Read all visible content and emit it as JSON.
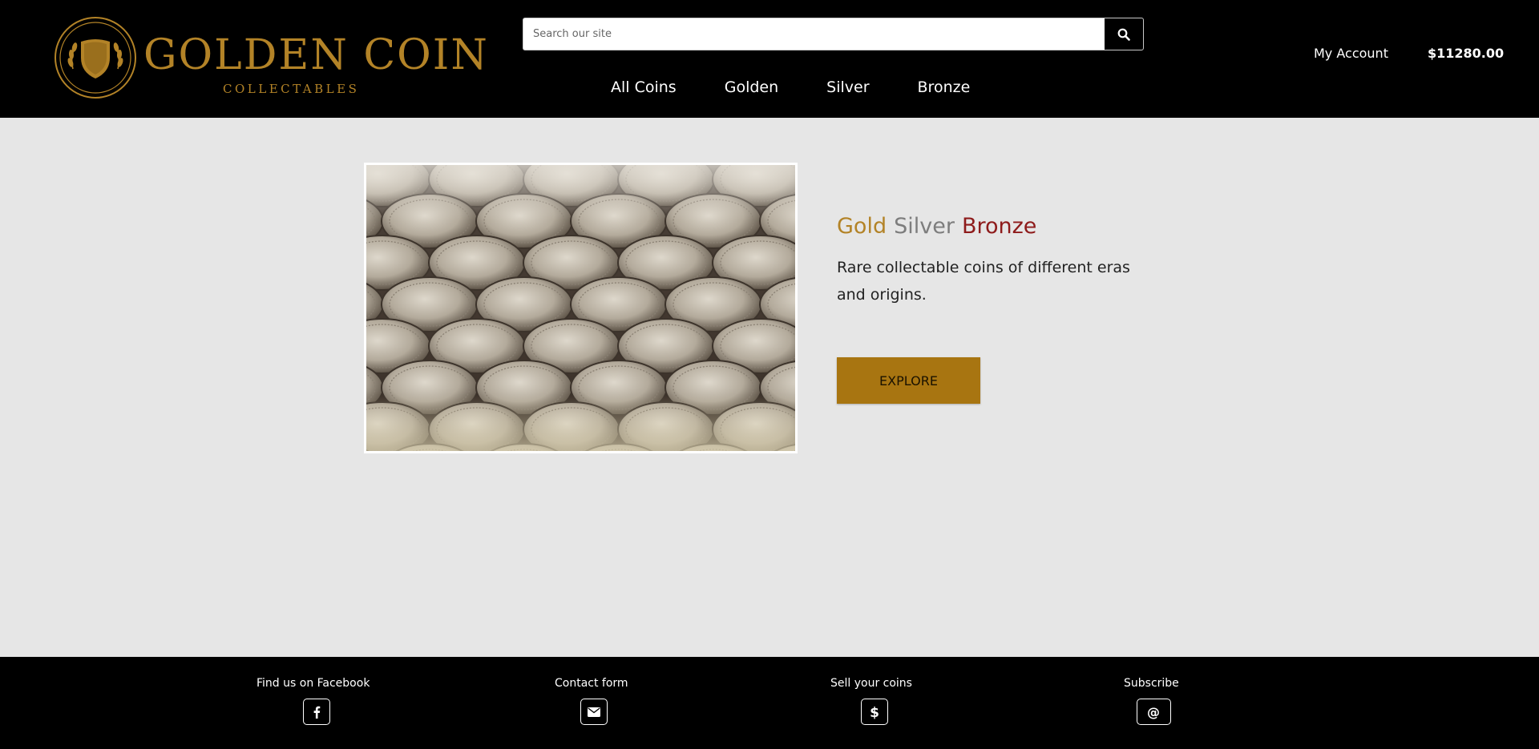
{
  "header": {
    "logo": {
      "title": "GOLDEN COIN",
      "subtitle": "COLLECTABLES",
      "icon": "shield-laurel-coin-icon"
    },
    "search": {
      "placeholder": "Search our site",
      "value": "",
      "button_icon": "search-icon"
    },
    "nav": [
      {
        "label": "All Coins"
      },
      {
        "label": "Golden"
      },
      {
        "label": "Silver"
      },
      {
        "label": "Bronze"
      }
    ],
    "account_label": "My Account",
    "cart_total": "$11280.00"
  },
  "hero": {
    "heading": [
      {
        "text": "Gold",
        "color": "#b38327"
      },
      {
        "text": "Silver",
        "color": "#7d7d7d"
      },
      {
        "text": "Bronze",
        "color": "#8e1b1b"
      }
    ],
    "description": "Rare collectable coins of different eras and origins.",
    "button_label": "EXPLORE"
  },
  "footer": {
    "items": [
      {
        "label": "Find us on Facebook",
        "icon": "facebook-icon"
      },
      {
        "label": "Contact form",
        "icon": "envelope-icon"
      },
      {
        "label": "Sell your coins",
        "icon": "dollar-icon"
      },
      {
        "label": "Subscribe",
        "icon": "at-sign-icon"
      }
    ]
  },
  "colors": {
    "header_bg": "#000000",
    "brand_gold": "#b38327",
    "button_gold": "#a87511",
    "page_bg": "#e6e6e6"
  }
}
